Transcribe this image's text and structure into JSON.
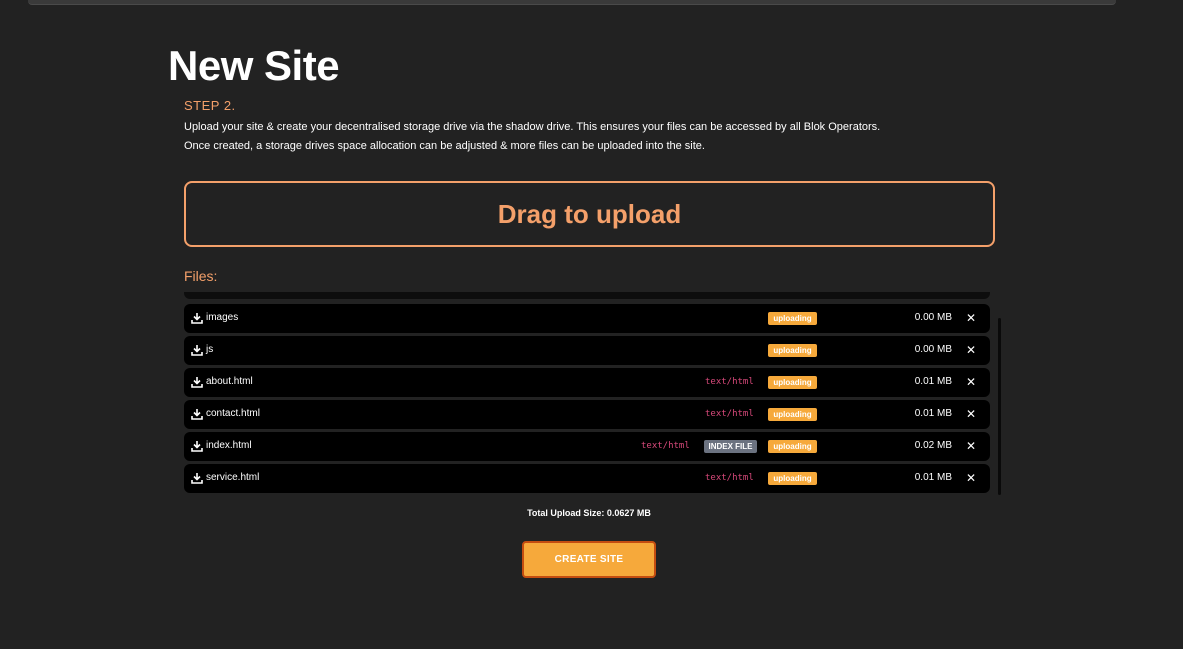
{
  "page": {
    "title": "New Site"
  },
  "step": {
    "label": "STEP 2.",
    "description_line_1": "Upload your site & create your decentralised storage drive via the shadow drive. This ensures your files can be accessed by all Blok Operators.",
    "description_line_2": "Once created, a storage drives space allocation can be adjusted & more files can be uploaded into the site."
  },
  "dropzone": {
    "label": "Drag to upload"
  },
  "files": {
    "label": "Files:",
    "items": [
      {
        "name": "images",
        "mime": "",
        "index_badge": "",
        "status": "uploading",
        "size": "0.00 MB",
        "remove": "✕"
      },
      {
        "name": "js",
        "mime": "",
        "index_badge": "",
        "status": "uploading",
        "size": "0.00 MB",
        "remove": "✕"
      },
      {
        "name": "about.html",
        "mime": "text/html",
        "index_badge": "",
        "status": "uploading",
        "size": "0.01 MB",
        "remove": "✕"
      },
      {
        "name": "contact.html",
        "mime": "text/html",
        "index_badge": "",
        "status": "uploading",
        "size": "0.01 MB",
        "remove": "✕"
      },
      {
        "name": "index.html",
        "mime": "text/html",
        "index_badge": "INDEX FILE",
        "status": "uploading",
        "size": "0.02 MB",
        "remove": "✕"
      },
      {
        "name": "service.html",
        "mime": "text/html",
        "index_badge": "",
        "status": "uploading",
        "size": "0.01 MB",
        "remove": "✕"
      }
    ]
  },
  "summary": {
    "total_upload_size": "Total Upload Size: 0.0627 MB"
  },
  "actions": {
    "create_label": "CREATE SITE"
  },
  "icons": {
    "file_row": "download-icon",
    "remove": "close-icon"
  },
  "colors": {
    "background": "#222222",
    "accent": "#f4a06a",
    "status_badge": "#f6a93b",
    "index_badge": "#6b7280",
    "mime_text": "#d7497a",
    "row_background": "#000000",
    "button_border": "#c44d10"
  }
}
